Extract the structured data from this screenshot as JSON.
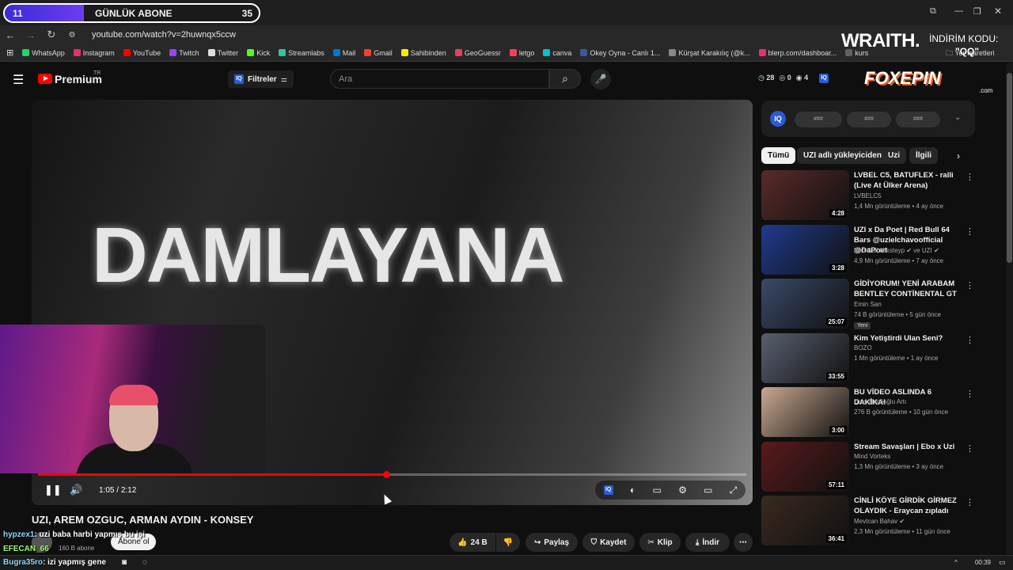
{
  "overlay": {
    "sub_count_left": "11",
    "sub_label": "GÜNLÜK ABONE",
    "sub_count_right": "35",
    "sub_progress": 0.31
  },
  "browser": {
    "url": "youtube.com/watch?v=2huwnqx5ccw",
    "bookmarks_label": "Yer İşaretleri",
    "bookmarks": [
      {
        "label": "WhatsApp",
        "color": "#25d366"
      },
      {
        "label": "Instagram",
        "color": "#e1306c"
      },
      {
        "label": "YouTube",
        "color": "#ff0000"
      },
      {
        "label": "Twitch",
        "color": "#9146ff"
      },
      {
        "label": "Twitter",
        "color": "#dddddd"
      },
      {
        "label": "Kick",
        "color": "#53fc18"
      },
      {
        "label": "Streamlabs",
        "color": "#31c3a2"
      },
      {
        "label": "Mail",
        "color": "#0078d4"
      },
      {
        "label": "Gmail",
        "color": "#ea4335"
      },
      {
        "label": "Sahibinden",
        "color": "#ffe800"
      },
      {
        "label": "GeoGuessr",
        "color": "#e83e5c"
      },
      {
        "label": "letgo",
        "color": "#ff3f55"
      },
      {
        "label": "canva",
        "color": "#00c4cc"
      },
      {
        "label": "Okey Oyna - Canlı 1...",
        "color": "#3b5998"
      },
      {
        "label": "Kürşat Karakılıç (@k...",
        "color": "#888888"
      },
      {
        "label": "blerp.com/dashboar...",
        "color": "#e5307a"
      },
      {
        "label": "kurs",
        "color": "#5f6368"
      }
    ]
  },
  "sponsor": {
    "brand": "WRAITH.",
    "discount_label": "İNDİRİM KODU:",
    "code": "\"QQ\"",
    "brand2": "FOXEPIN",
    "brand2_domain": ".com"
  },
  "header": {
    "premium_label": "Premium",
    "region": "TR",
    "filters_label": "Filtreler",
    "search_placeholder": "Ara",
    "stats": {
      "clock": "28",
      "circle": "0",
      "eye": "4"
    }
  },
  "video": {
    "art_text": "DAMLAYANA",
    "current_time": "1:05",
    "duration": "2:12",
    "progress": 0.492,
    "title": "UZI, AREM OZGUC, ARMAN AYDIN - KONSEY",
    "channel_subs": "160 B abone",
    "subscribe_label": "Abone ol",
    "actions": {
      "likes": "24 B",
      "share": "Paylaş",
      "save": "Kaydet",
      "clip": "Klip",
      "download": "İndir"
    }
  },
  "chat": [
    {
      "user": "hypzex1",
      "message": "uzi baba harbi yapmış bu işi"
    },
    {
      "user": "EFECAN_66",
      "message": ""
    },
    {
      "user": "Bugra35ro",
      "message": "izi yapmış gene"
    }
  ],
  "sidebar": {
    "panel_pills": [
      "###",
      "###",
      "###"
    ],
    "chips": [
      "Tümü",
      "UZI adlı yükleyiciden",
      "Uzi",
      "İlgili"
    ],
    "recommendations": [
      {
        "title": "LVBEL C5, BATUFLEX - ralli (Live At Ülker Arena)",
        "channel": "LVBELC5",
        "meta": "1,4 Mn görüntüleme • 4 ay önce",
        "duration": "4:28",
        "thumb": "#5a2a2a",
        "badge": ""
      },
      {
        "title": "UZI x Da Poet | Red Bull 64 Bars @uzielchavoofficial @DaPoet",
        "channel": "Red Bull Miksteyp ✔ ve UZI ✔",
        "meta": "4,9 Mn görüntüleme • 7 ay önce",
        "duration": "3:28",
        "thumb": "#1f3b8f",
        "badge": ""
      },
      {
        "title": "GİDİYORUM! YENİ ARABAM BENTLEY CONTİNENTAL GT",
        "channel": "Emin San",
        "meta": "74 B görüntüleme • 5 gün önce",
        "duration": "25:07",
        "thumb": "#3a4a6a",
        "badge": "Yeni"
      },
      {
        "title": "Kim Yetiştirdi Ulan Seni?",
        "channel": "BOZO",
        "meta": "1 Mn görüntüleme • 1 ay önce",
        "duration": "33:55",
        "thumb": "#5a6070",
        "badge": ""
      },
      {
        "title": "BU VİDEO ASLINDA 6 DAKİKA!",
        "channel": "Uras Benlioğlu Artı",
        "meta": "276 B görüntüleme • 10 gün önce",
        "duration": "3:00",
        "thumb": "#c9a890",
        "badge": ""
      },
      {
        "title": "Stream Savaşları | Ebo x Uzi",
        "channel": "Mind Vorteks",
        "meta": "1,3 Mn görüntüleme • 3 ay önce",
        "duration": "57:11",
        "thumb": "#5a1a1a",
        "badge": ""
      },
      {
        "title": "CİNLİ KÖYE GİRDİK GİRMEZ OLAYDIK - Eraycan zıpladı",
        "channel": "Mevtcan Bahav ✔",
        "meta": "2,3 Mn görüntüleme • 11 gün önce",
        "duration": "36:41",
        "thumb": "#3a2a20",
        "badge": ""
      }
    ]
  },
  "taskbar": {
    "clock": "00:39"
  }
}
